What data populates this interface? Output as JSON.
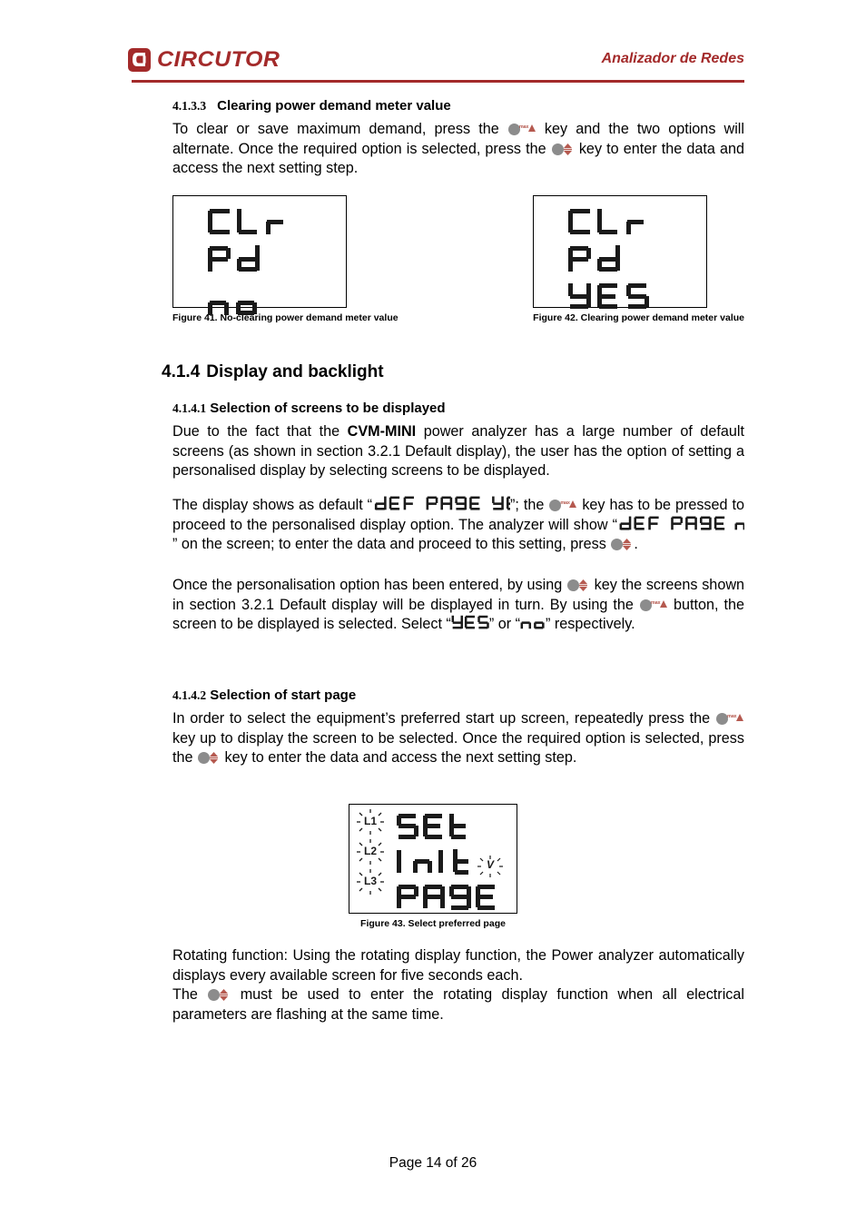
{
  "header": {
    "logo_text": "CIRCUTOR",
    "logo_icon": "circutor-c-logo",
    "right_title": "Analizador de Redes",
    "accent_color": "#a32a2a"
  },
  "sections": {
    "s4133": {
      "number": "4.1.3.3",
      "title": "Clearing power demand meter value",
      "paragraph": {
        "part1": "To clear or save maximum demand, press the ",
        "part2": " key and the two options will alternate. Once the required option is selected, press the ",
        "part3": " key to enter the data and access the next setting step."
      }
    },
    "s414": {
      "number": "4.1.4",
      "title": "Display and backlight"
    },
    "s4141": {
      "number": "4.1.4.1",
      "title": "Selection of screens to be displayed",
      "paragraph": {
        "part1": "Due to the fact that the ",
        "bold": "CVM-MINI",
        "part2": " power analyzer has a large number of default screens (as shown in section 3.2.1 Default display), the user has the option of setting a personalised display by selecting screens to be displayed."
      },
      "paragraph2": {
        "part1": "The display shows as default “",
        "lcd1": "dEF PAGE YES",
        "part2": "”; the ",
        "part3": " key has to be pressed to proceed to the personalised display option. The analyzer will show “",
        "lcd2": "dEF PAGE no",
        "part4": "” on the screen; to enter the data and proceed to this setting, press ",
        "part5": "."
      },
      "paragraph3": {
        "part1": "Once the personalisation option has been entered, by using ",
        "part2": " key the screens shown in section 3.2.1 Default display will be displayed in turn. By using the ",
        "part3": " button, the screen to be displayed is selected. Select “",
        "lcd1": "YES",
        "part4": "” or “",
        "lcd2": "no",
        "part5": "” respectively."
      }
    },
    "s4142": {
      "number": "4.1.4.2",
      "title": "Selection of start page",
      "paragraph": {
        "part1": "In order to select the equipment’s preferred start up screen, repeatedly press the ",
        "part2": " key up to display the screen to be selected. Once the required option is selected, press the ",
        "part3": " key to enter the data and access the next setting step."
      }
    },
    "rotating": {
      "paragraph1": "Rotating function: Using the rotating display function, the Power analyzer automatically displays every available screen for five seconds each.",
      "paragraph2": {
        "part1": "The ",
        "part2": " must be used to enter the rotating display function when all electrical parameters are flashing at the same time."
      }
    }
  },
  "keys": {
    "max_key": {
      "icon": "max-up-key-icon",
      "label": "max",
      "arrow": "triangle-up"
    },
    "updown_key": {
      "icon": "up-down-arrow-key-icon",
      "arrow": "double-arrow-vertical"
    },
    "dot_color": "#8c8c8c",
    "arrow_color": "#b5594f"
  },
  "figures": [
    {
      "id": "figure-41",
      "caption": "Figure 41. No-clearing power demand meter value",
      "lines": [
        "CLr",
        "Pd",
        "no"
      ]
    },
    {
      "id": "figure-42",
      "caption": "Figure 42. Clearing power demand meter value",
      "lines": [
        "CLr",
        "Pd",
        "YES"
      ]
    },
    {
      "id": "figure-43",
      "caption": "Figure 43. Select preferred page",
      "lines": [
        "SEt",
        "Init",
        "PAGE"
      ],
      "phase_labels": [
        "L1",
        "L2",
        "L3"
      ],
      "unit_label": "V",
      "flashing": true
    }
  ],
  "footer": {
    "page_text": "Page 14 of 26"
  }
}
